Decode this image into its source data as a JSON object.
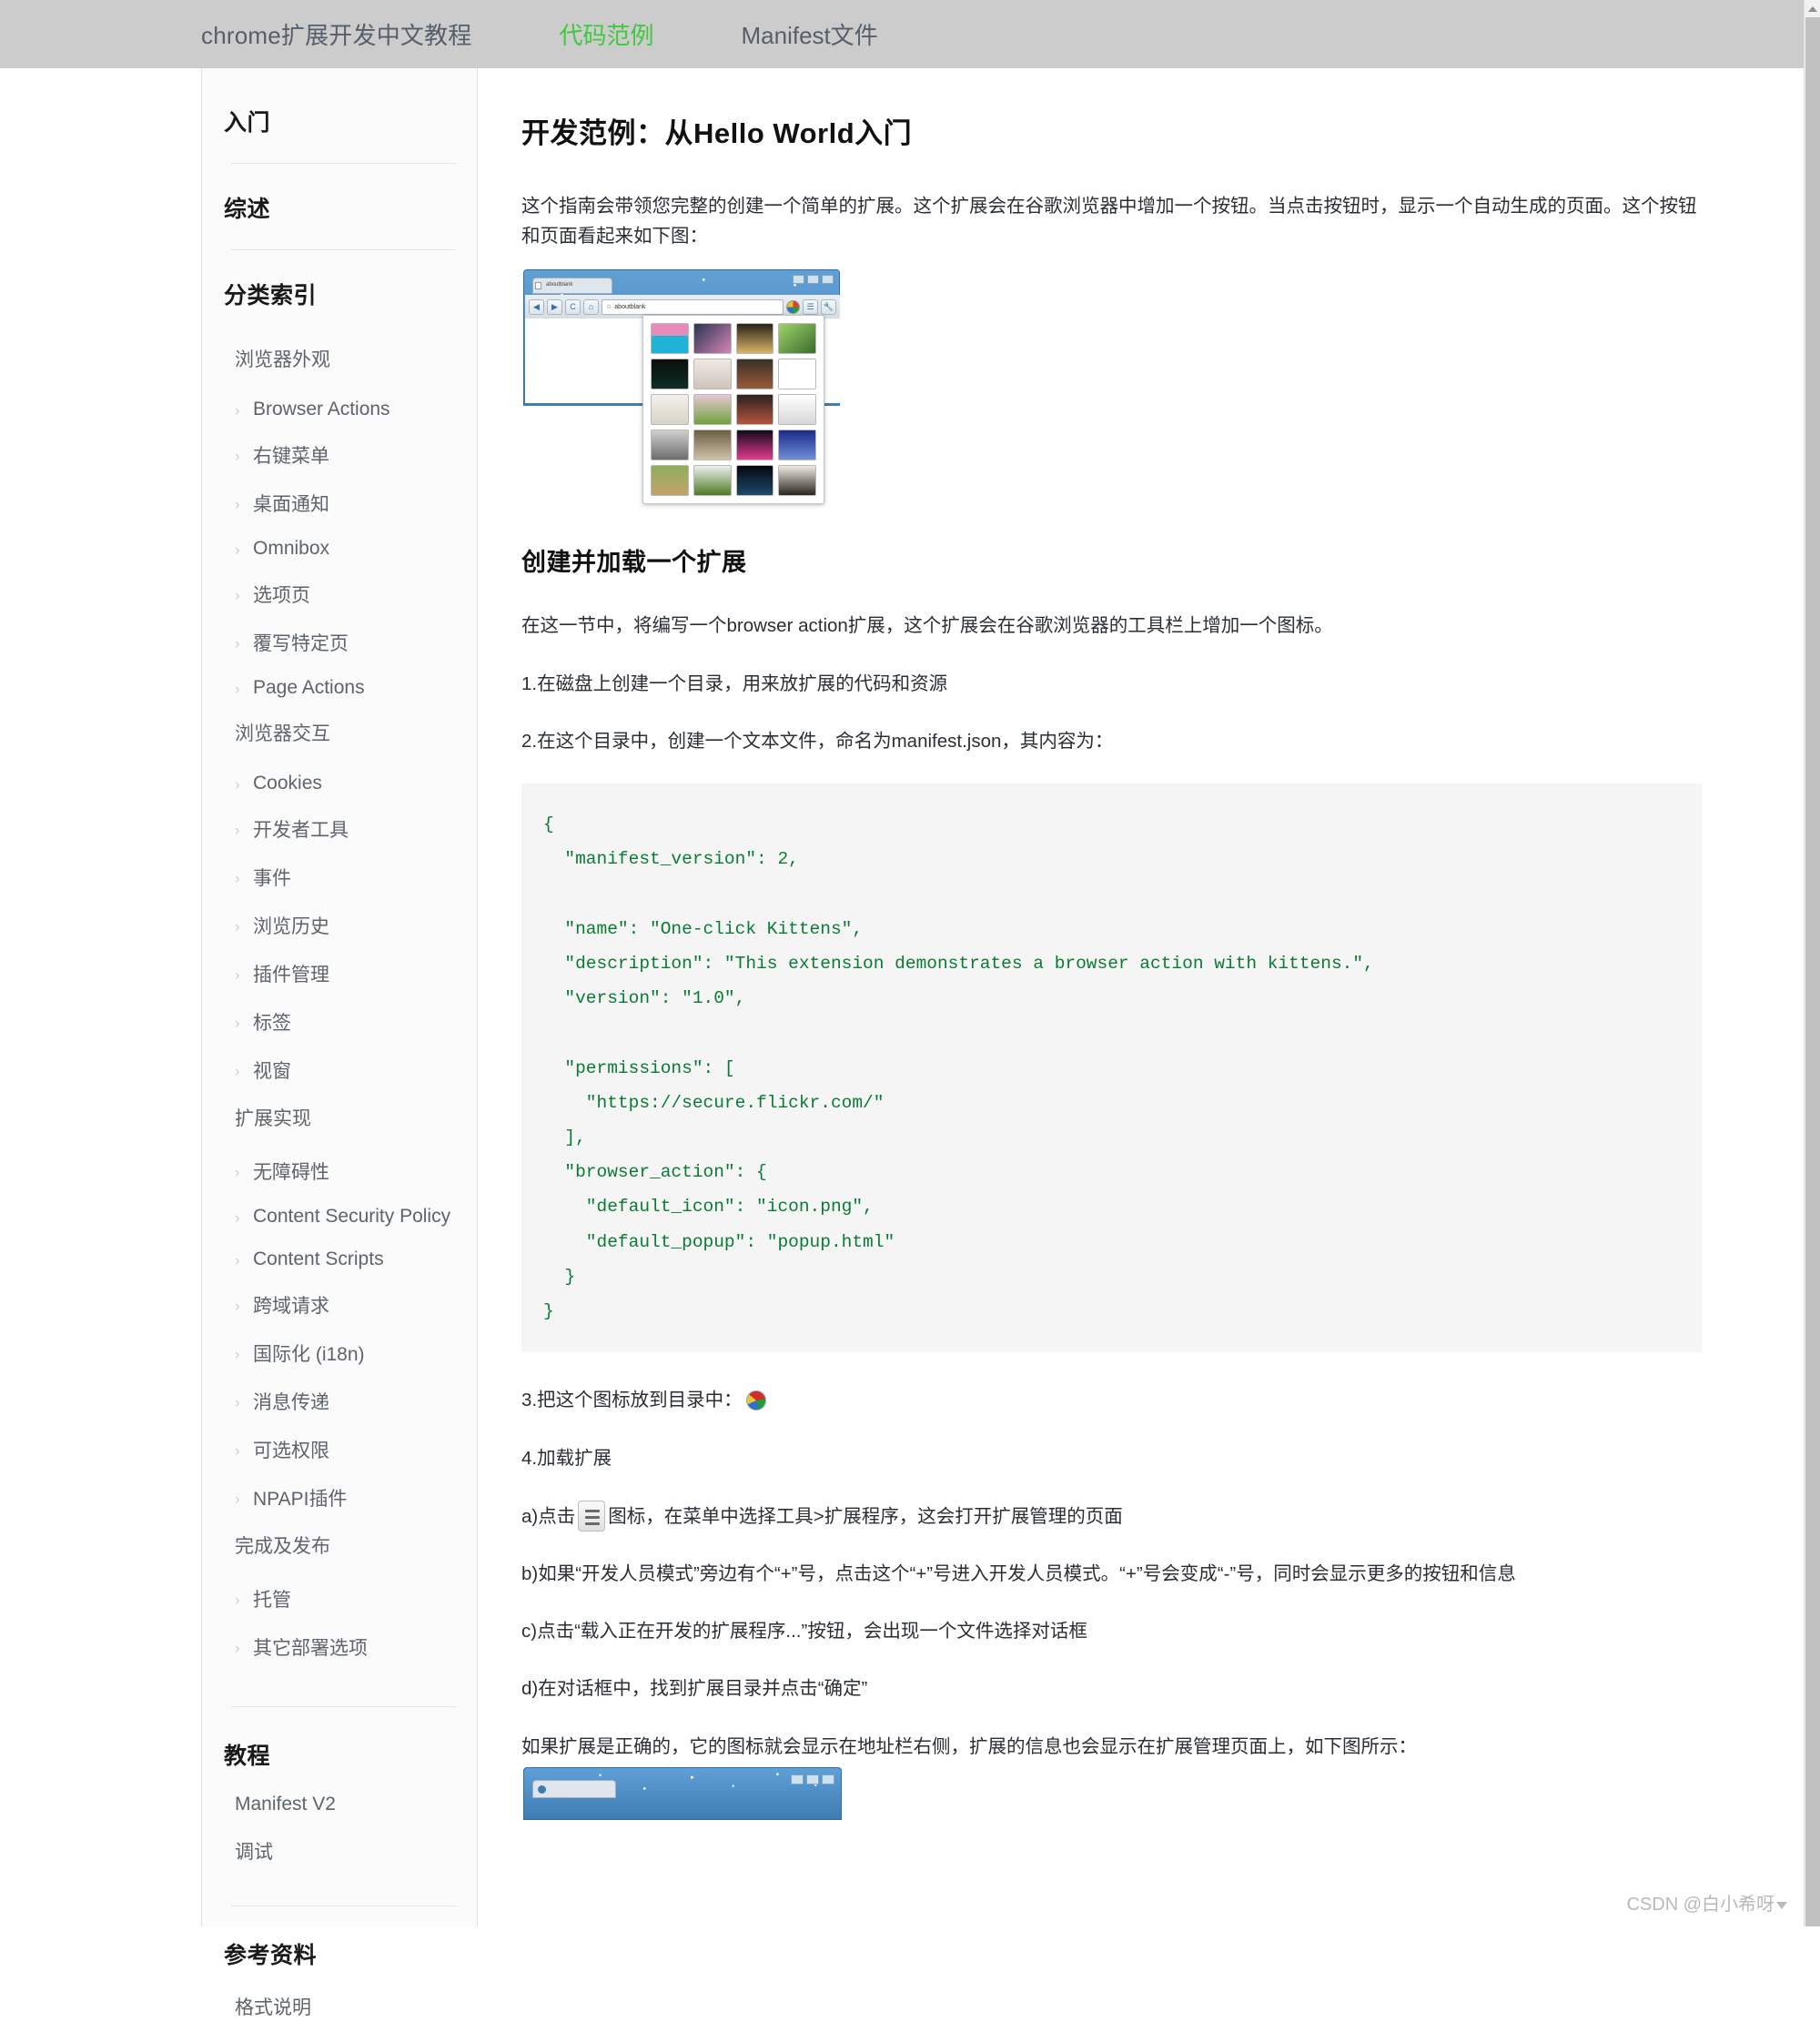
{
  "topnav": {
    "brand": "chrome扩展开发中文教程",
    "links": [
      {
        "label": "代码范例",
        "active": true
      },
      {
        "label": "Manifest文件",
        "active": false
      }
    ]
  },
  "sidebar": {
    "heading_start": "入门",
    "heading_overview": "综述",
    "heading_index": "分类索引",
    "heading_tutorial": "教程",
    "heading_reference": "参考资料",
    "groups": [
      {
        "label": "浏览器外观",
        "items": [
          "Browser Actions",
          "右键菜单",
          "桌面通知",
          "Omnibox",
          "选项页",
          "覆写特定页",
          "Page Actions"
        ]
      },
      {
        "label": "浏览器交互",
        "items": [
          "Cookies",
          "开发者工具",
          "事件",
          "浏览历史",
          "插件管理",
          "标签",
          "视窗"
        ]
      },
      {
        "label": "扩展实现",
        "items": [
          "无障碍性",
          "Content Security Policy",
          "Content Scripts",
          "跨域请求",
          "国际化 (i18n)",
          "消息传递",
          "可选权限",
          "NPAPI插件"
        ]
      },
      {
        "label": "完成及发布",
        "items": [
          "托管",
          "其它部署选项"
        ]
      }
    ],
    "tutorial_items": [
      "Manifest V2",
      "调试"
    ],
    "reference_items": [
      "格式说明"
    ],
    "chevron": "›"
  },
  "main": {
    "title": "开发范例：从Hello World入门",
    "intro": "这个指南会带领您完整的创建一个简单的扩展。这个扩展会在谷歌浏览器中增加一个按钮。当点击按钮时，显示一个自动生成的页面。这个按钮和页面看起来如下图：",
    "figure1": {
      "tab_label": "aboutblank",
      "url": "aboutblank"
    },
    "section_title": "创建并加载一个扩展",
    "p1": "在这一节中，将编写一个browser action扩展，这个扩展会在谷歌浏览器的工具栏上增加一个图标。",
    "step1": "1.在磁盘上创建一个目录，用来放扩展的代码和资源",
    "step2": "2.在这个目录中，创建一个文本文件，命名为manifest.json，其内容为：",
    "code": "{\n  \"manifest_version\": 2,\n\n  \"name\": \"One-click Kittens\",\n  \"description\": \"This extension demonstrates a browser action with kittens.\",\n  \"version\": \"1.0\",\n\n  \"permissions\": [\n    \"https://secure.flickr.com/\"\n  ],\n  \"browser_action\": {\n    \"default_icon\": \"icon.png\",\n    \"default_popup\": \"popup.html\"\n  }\n}",
    "step3_prefix": "3.把这个图标放到目录中：",
    "step4": "4.加载扩展",
    "step_a_prefix": "a)点击",
    "step_a_suffix": "图标，在菜单中选择工具>扩展程序，这会打开扩展管理的页面",
    "step_b": "b)如果“开发人员模式”旁边有个“+”号，点击这个“+”号进入开发人员模式。“+”号会变成“-”号，同时会显示更多的按钮和信息",
    "step_c": "c)点击“载入正在开发的扩展程序...”按钮，会出现一个文件选择对话框",
    "step_d": "d)在对话框中，找到扩展目录并点击“确定”",
    "closing": "如果扩展是正确的，它的图标就会显示在地址栏右侧，扩展的信息也会显示在扩展管理页面上，如下图所示："
  },
  "watermark": "CSDN @白小希呀",
  "colors": {
    "nav_bg": "#cccccc",
    "nav_active": "#3ec93e",
    "code_text": "#0a7b34",
    "code_bg": "#f5f5f5",
    "sidebar_bg": "#fbfbfb"
  }
}
